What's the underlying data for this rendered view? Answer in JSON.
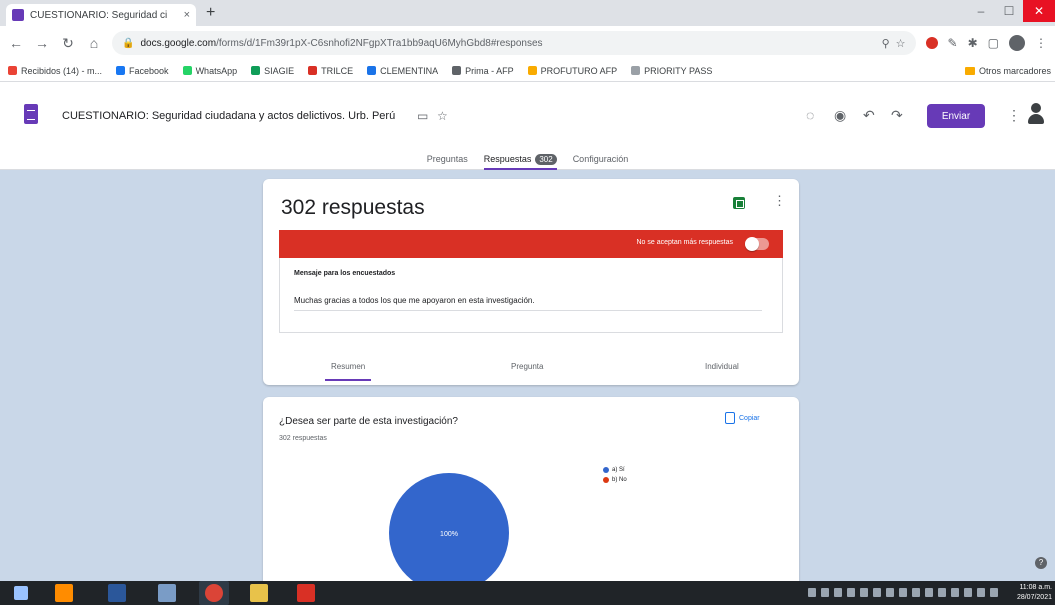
{
  "browser": {
    "tab_title": "CUESTIONARIO: Seguridad ci",
    "tab_close": "×",
    "new_tab": "+",
    "url_host": "docs.google.com",
    "url_path": "/forms/d/1Fm39r1pX-C6snhofi2NFgpXTra1bb9aqU6MyhGbd8#responses",
    "win_min": "–",
    "win_max": "☐",
    "win_close": "✕"
  },
  "bookmarks": {
    "items": [
      {
        "label": "Recibidos (14) - m...",
        "color": "#ea4335"
      },
      {
        "label": "Facebook",
        "color": "#1877f2"
      },
      {
        "label": "WhatsApp",
        "color": "#25d366"
      },
      {
        "label": "SIAGIE",
        "color": "#0f9d58"
      },
      {
        "label": "TRILCE",
        "color": "#d93025"
      },
      {
        "label": "CLEMENTINA",
        "color": "#1a73e8"
      },
      {
        "label": "Prima - AFP",
        "color": "#5f6368"
      },
      {
        "label": "PROFUTURO AFP",
        "color": "#f9ab00"
      },
      {
        "label": "PRIORITY PASS",
        "color": "#9aa0a6"
      }
    ],
    "other": "Otros marcadores"
  },
  "form": {
    "title": "CUESTIONARIO: Seguridad ciudadana y actos delictivos. Urb. Perú",
    "send_label": "Enviar",
    "tabs": {
      "questions": "Preguntas",
      "responses": "Respuestas",
      "responses_count": "302",
      "settings": "Configuración"
    }
  },
  "responses": {
    "count_label": "302 respuestas",
    "accepting_label": "No se aceptan más respuestas",
    "message_label": "Mensaje para los encuestados",
    "message_text": "Muchas gracias a todos los que me apoyaron en esta investigación.",
    "subtabs": {
      "summary": "Resumen",
      "question": "Pregunta",
      "individual": "Individual"
    }
  },
  "question_card": {
    "title": "¿Desea ser parte de esta investigación?",
    "count": "302 respuestas",
    "copy_label": "Copiar"
  },
  "chart_data": {
    "type": "pie",
    "categories": [
      "a) Sí",
      "b) No"
    ],
    "values": [
      100,
      0
    ],
    "colors": [
      "#3366cc",
      "#dc3912"
    ],
    "data_labels": [
      "100%",
      ""
    ],
    "legend": "right"
  },
  "taskbar": {
    "time": "11:08 a.m.",
    "date": "28/07/2021"
  },
  "colors": {
    "accent": "#673ab7",
    "closed_banner": "#d93025",
    "page_bg": "#c9d7e8"
  }
}
